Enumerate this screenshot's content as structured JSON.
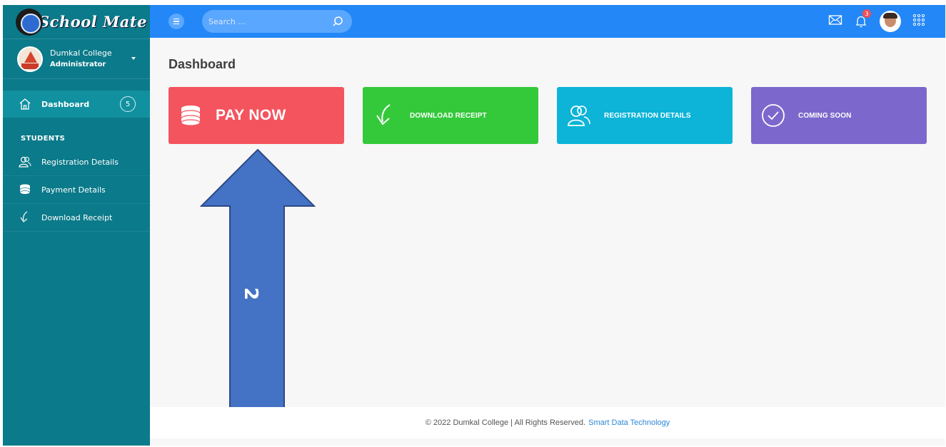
{
  "app": {
    "logo_text": "School Mate"
  },
  "profile": {
    "name": "Dumkal College",
    "role": "Administrator"
  },
  "sidebar": {
    "active_item": {
      "label": "Dashboard",
      "icon": "home-icon",
      "badge": "5"
    },
    "section_title": "STUDENTS",
    "items": [
      {
        "label": "Registration Details",
        "icon": "users-icon"
      },
      {
        "label": "Payment Details",
        "icon": "coins-icon"
      },
      {
        "label": "Download Receipt",
        "icon": "download-icon"
      }
    ]
  },
  "topbar": {
    "search_placeholder": "Search ...",
    "notification_count": "3"
  },
  "main": {
    "title": "Dashboard",
    "cards": [
      {
        "label": "PAY NOW",
        "icon": "coins-icon",
        "color": "#f4545e"
      },
      {
        "label": "DOWNLOAD RECEIPT",
        "icon": "download-icon",
        "color": "#34c93b"
      },
      {
        "label": "REGISTRATION DETAILS",
        "icon": "users-icon",
        "color": "#0db4d8"
      },
      {
        "label": "COMING SOON",
        "icon": "check-circle-icon",
        "color": "#7c68cc"
      }
    ]
  },
  "annotation": {
    "step_label": "2",
    "color": "#4472c4"
  },
  "footer": {
    "copyright": "© 2022 Dumkal College | All Rights Reserved.",
    "link_text": "Smart Data Technology"
  },
  "colors": {
    "sidebar": "#0b7a8a",
    "topbar": "#2387f7"
  }
}
